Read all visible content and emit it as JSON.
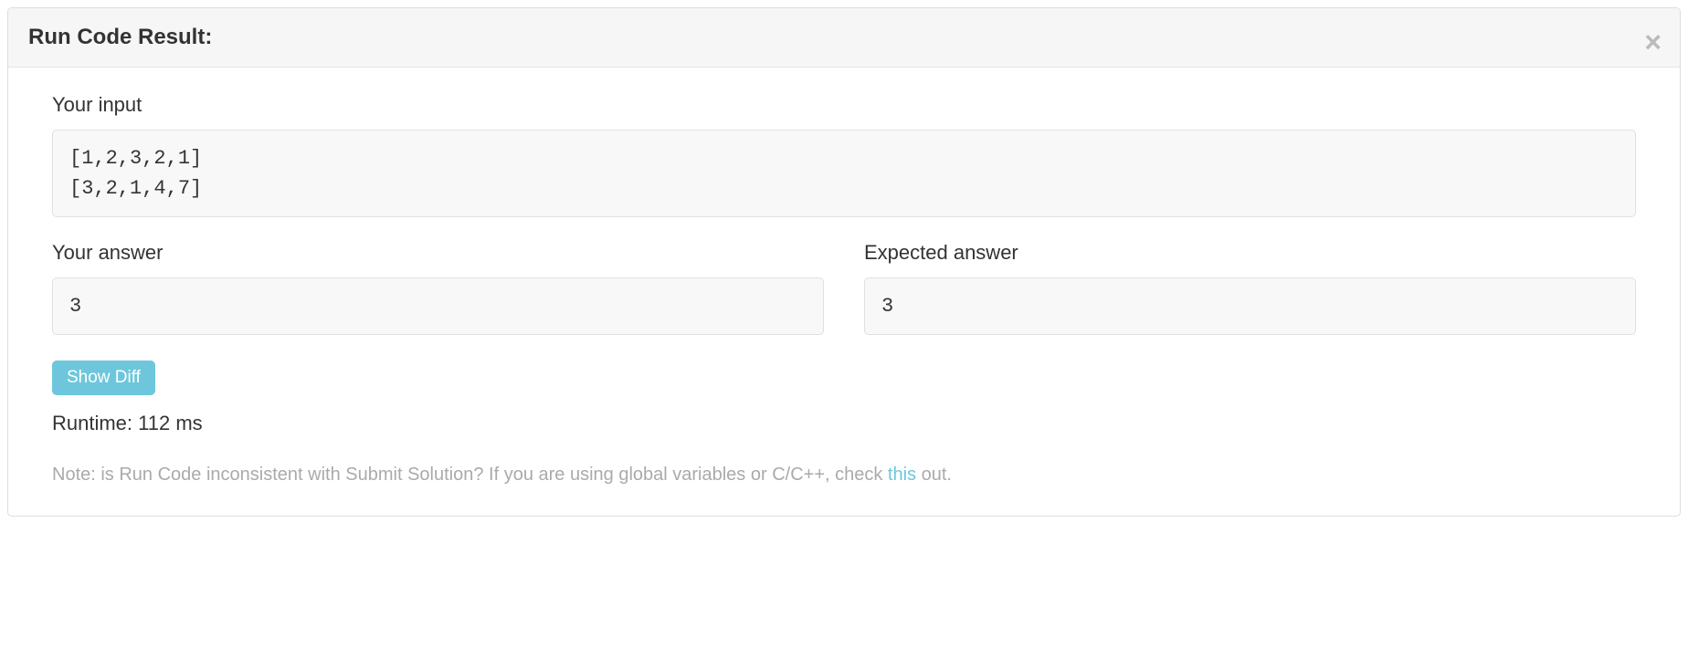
{
  "header": {
    "title": "Run Code Result:"
  },
  "input": {
    "label": "Your input",
    "value": "[1,2,3,2,1]\n[3,2,1,4,7]"
  },
  "yourAnswer": {
    "label": "Your answer",
    "value": "3"
  },
  "expectedAnswer": {
    "label": "Expected answer",
    "value": "3"
  },
  "showDiff": {
    "label": "Show Diff"
  },
  "runtime": {
    "label": "Runtime: ",
    "value": "112 ms"
  },
  "note": {
    "prefix": "Note: is Run Code inconsistent with Submit Solution? If you are using global variables or C/C++, check ",
    "linkText": "this",
    "suffix": " out."
  }
}
